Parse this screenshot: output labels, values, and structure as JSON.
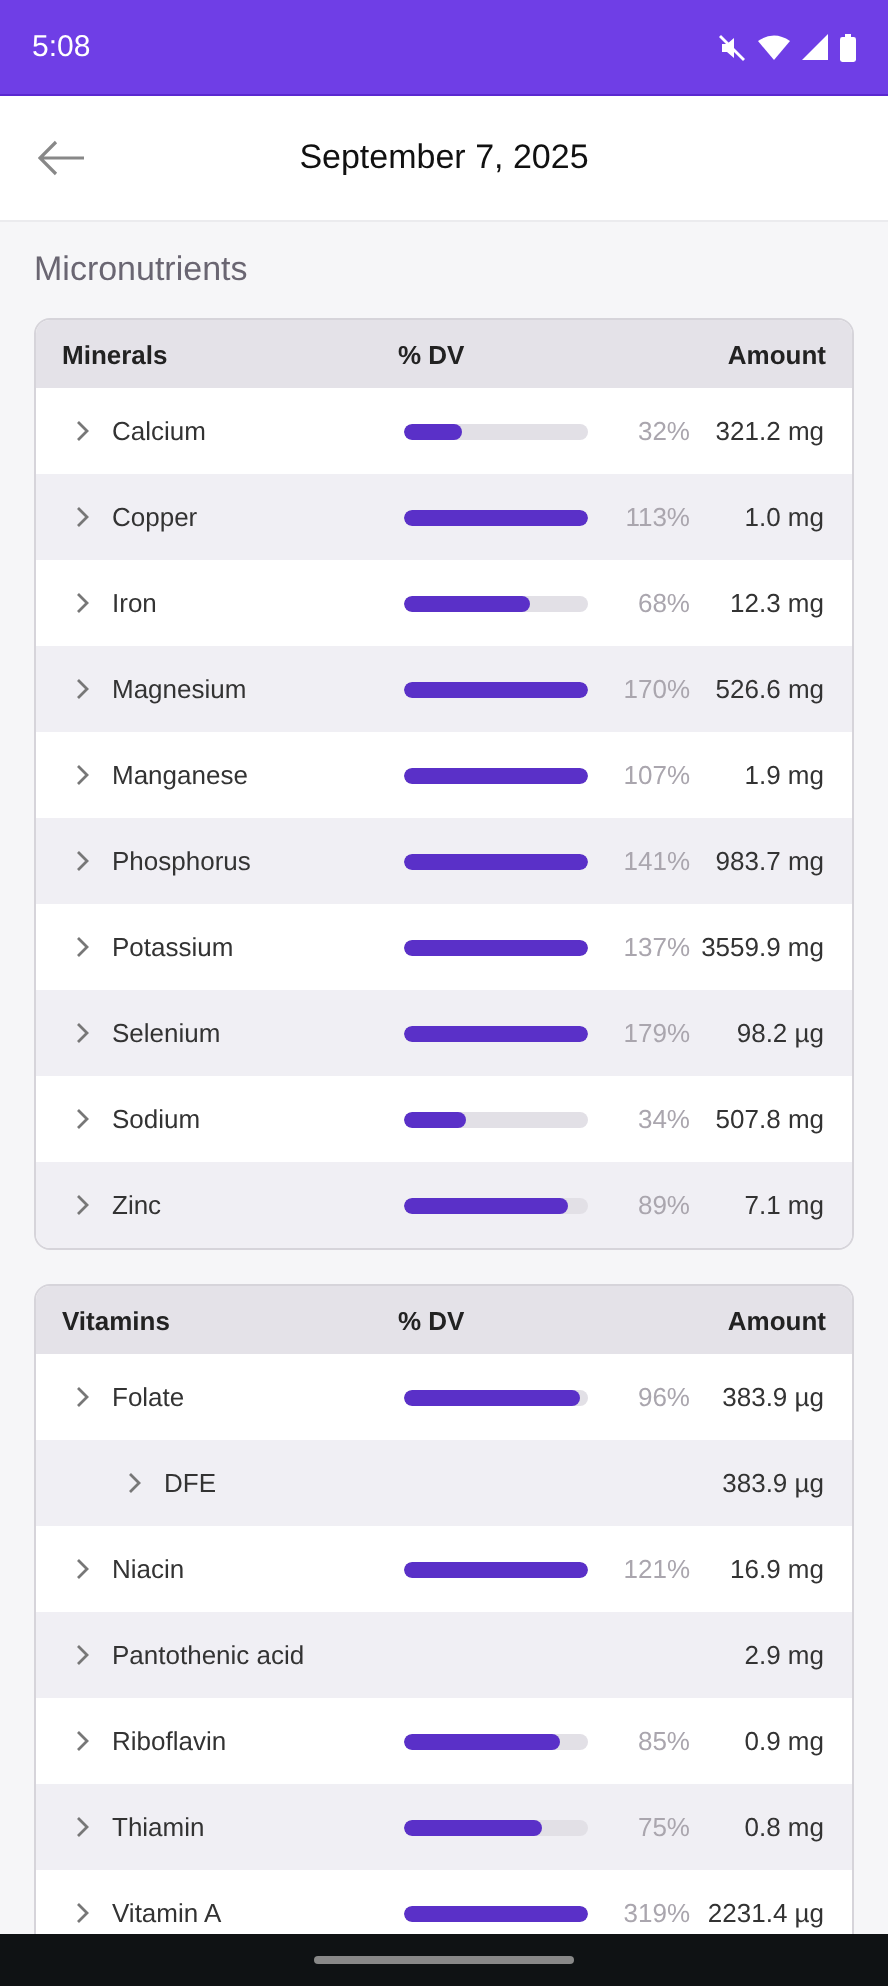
{
  "status_bar": {
    "time": "5:08"
  },
  "header": {
    "title": "September 7, 2025"
  },
  "section_title": "Micronutrients",
  "tables": [
    {
      "columns": [
        "Minerals",
        "% DV",
        "Amount"
      ],
      "rows": [
        {
          "name": "Calcium",
          "level": 0.32,
          "percent": "32%",
          "amount": "321.2 mg"
        },
        {
          "name": "Copper",
          "level": 1,
          "percent": "113%",
          "amount": "1.0 mg"
        },
        {
          "name": "Iron",
          "level": 0.68,
          "percent": "68%",
          "amount": "12.3 mg"
        },
        {
          "name": "Magnesium",
          "level": 1,
          "percent": "170%",
          "amount": "526.6 mg"
        },
        {
          "name": "Manganese",
          "level": 1,
          "percent": "107%",
          "amount": "1.9 mg"
        },
        {
          "name": "Phosphorus",
          "level": 1,
          "percent": "141%",
          "amount": "983.7 mg"
        },
        {
          "name": "Potassium",
          "level": 1,
          "percent": "137%",
          "amount": "3559.9 mg"
        },
        {
          "name": "Selenium",
          "level": 1,
          "percent": "179%",
          "amount": "98.2 µg"
        },
        {
          "name": "Sodium",
          "level": 0.34,
          "percent": "34%",
          "amount": "507.8 mg"
        },
        {
          "name": "Zinc",
          "level": 0.89,
          "percent": "89%",
          "amount": "7.1 mg"
        }
      ]
    },
    {
      "columns": [
        "Vitamins",
        "% DV",
        "Amount"
      ],
      "rows": [
        {
          "name": "Folate",
          "level": 0.96,
          "percent": "96%",
          "amount": "383.9 µg",
          "children": [
            {
              "name": "DFE",
              "amount": "383.9 µg"
            }
          ]
        },
        {
          "name": "Niacin",
          "level": 1,
          "percent": "121%",
          "amount": "16.9 mg"
        },
        {
          "name": "Pantothenic acid",
          "amount": "2.9 mg"
        },
        {
          "name": "Riboflavin",
          "level": 0.85,
          "percent": "85%",
          "amount": "0.9 mg"
        },
        {
          "name": "Thiamin",
          "level": 0.75,
          "percent": "75%",
          "amount": "0.8 mg"
        },
        {
          "name": "Vitamin A",
          "level": 1,
          "percent": "319%",
          "amount": "2231.4 µg"
        }
      ]
    }
  ]
}
